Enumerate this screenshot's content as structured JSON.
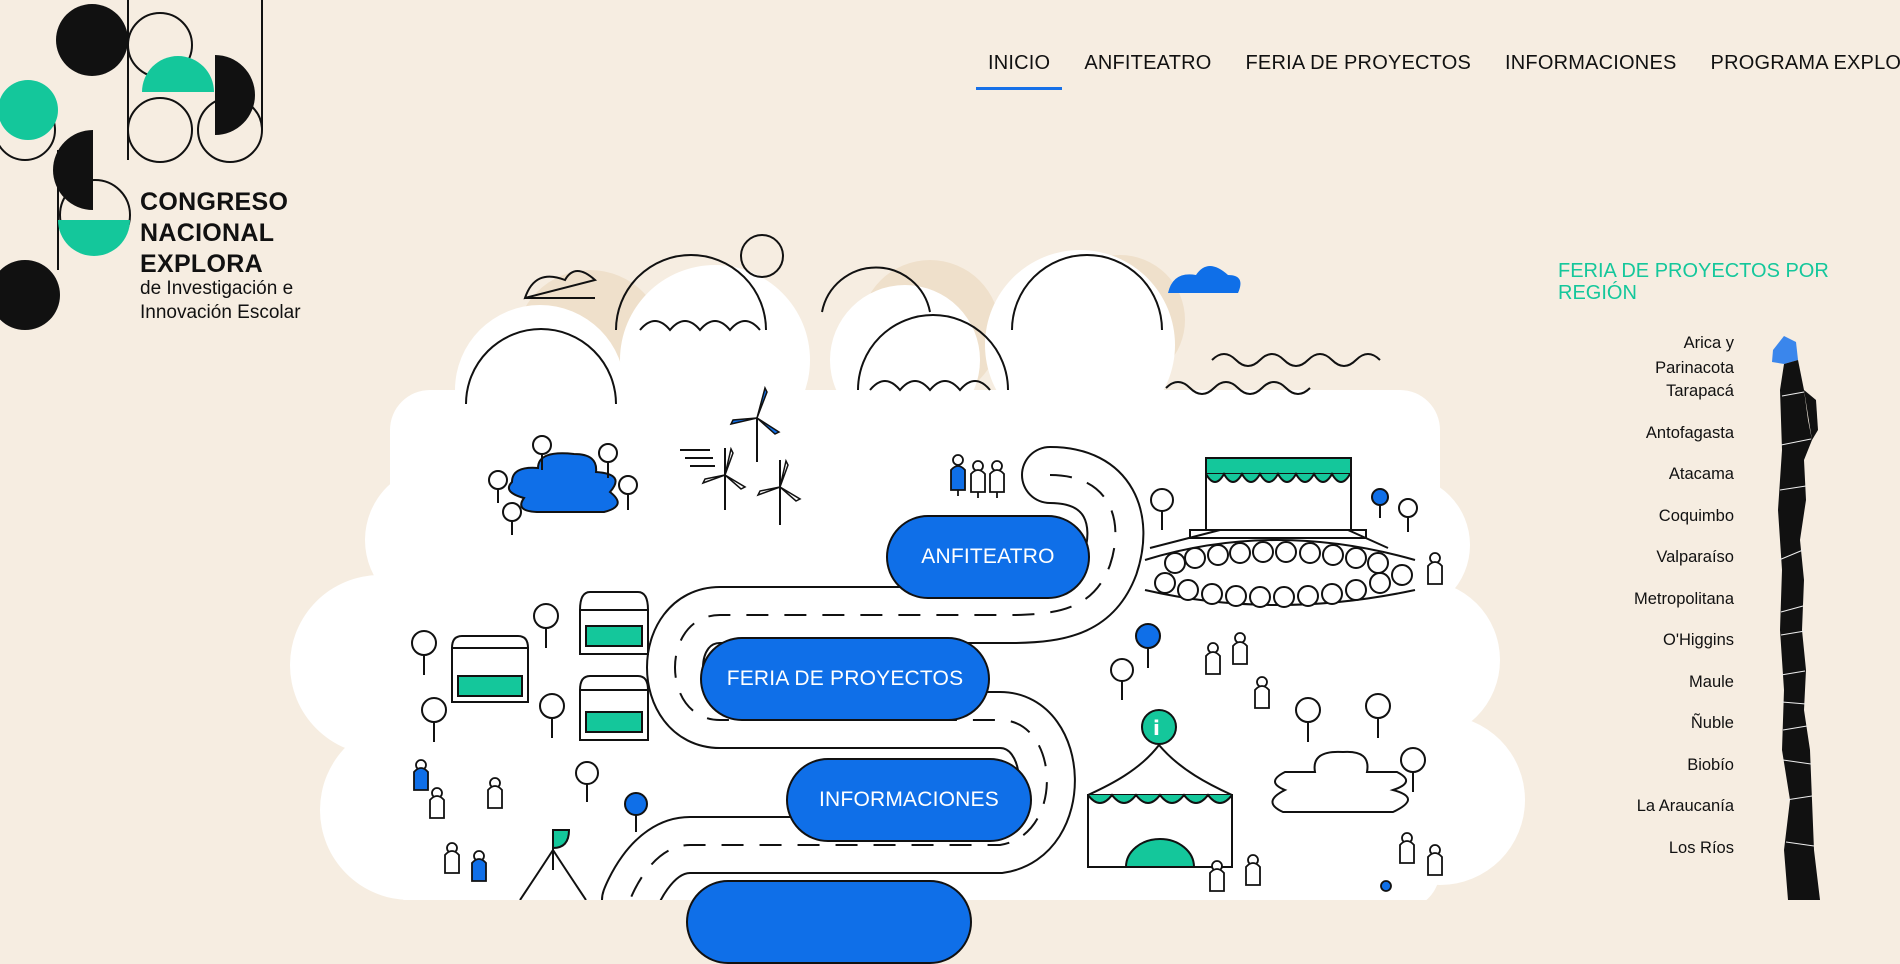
{
  "brand": {
    "title_lines": [
      "CONGRESO",
      "NACIONAL",
      "EXPLORA"
    ],
    "subtitle_lines": [
      "de Investigación e",
      "Innovación Escolar"
    ]
  },
  "nav": {
    "items": [
      "INICIO",
      "ANFITEATRO",
      "FERIA DE PROYECTOS",
      "INFORMACIONES",
      "PROGRAMA EXPLORA"
    ],
    "active": "INICIO"
  },
  "map_buttons": {
    "anfiteatro": "ANFITEATRO",
    "feria": "FERIA DE PROYECTOS",
    "informaciones": "INFORMACIONES"
  },
  "regions_panel": {
    "title": "FERIA DE PROYECTOS POR REGIÓN",
    "regions": [
      "Arica y Parinacota",
      "Tarapacá",
      "Antofagasta",
      "Atacama",
      "Coquimbo",
      "Valparaíso",
      "Metropolitana",
      "O'Higgins",
      "Maule",
      "Ñuble",
      "Biobío",
      "La Araucanía",
      "Los Ríos"
    ],
    "highlighted": "Arica y Parinacota"
  },
  "colors": {
    "background": "#f6ede1",
    "accent_blue": "#0f6fe8",
    "accent_green": "#14c79b",
    "ink": "#111111"
  }
}
